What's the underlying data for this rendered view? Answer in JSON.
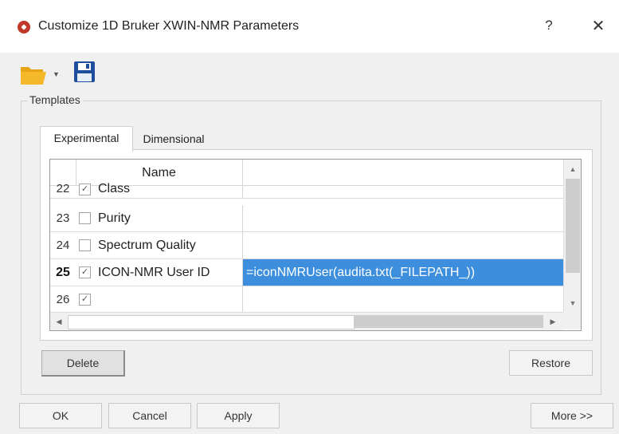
{
  "window": {
    "title": "Customize 1D Bruker XWIN-NMR Parameters",
    "help_label": "?",
    "close_label": "✕"
  },
  "toolbar": {
    "open_icon": "folder-open-icon",
    "save_icon": "save-floppy-icon",
    "accent_folder": "#f2b01e",
    "accent_save": "#1f4e9c"
  },
  "templates": {
    "group_title": "Templates",
    "tabs": [
      {
        "label": "Experimental",
        "active": true
      },
      {
        "label": "Dimensional",
        "active": false
      }
    ],
    "grid": {
      "header_name": "Name",
      "rows": [
        {
          "num": "22",
          "checked": true,
          "name": "Class",
          "value": ""
        },
        {
          "num": "23",
          "checked": false,
          "name": "Purity",
          "value": ""
        },
        {
          "num": "24",
          "checked": false,
          "name": "Spectrum Quality",
          "value": ""
        },
        {
          "num": "25",
          "checked": true,
          "name": "ICON-NMR User ID",
          "value": "=iconNMRUser(audita.txt(_FILEPATH_))",
          "selected": true
        },
        {
          "num": "26",
          "checked": true,
          "name": "",
          "value": ""
        }
      ],
      "selection_color": "#3d8fde"
    },
    "delete_label": "Delete",
    "restore_label": "Restore"
  },
  "footer": {
    "ok_label": "OK",
    "cancel_label": "Cancel",
    "apply_label": "Apply",
    "more_label": "More >>"
  }
}
